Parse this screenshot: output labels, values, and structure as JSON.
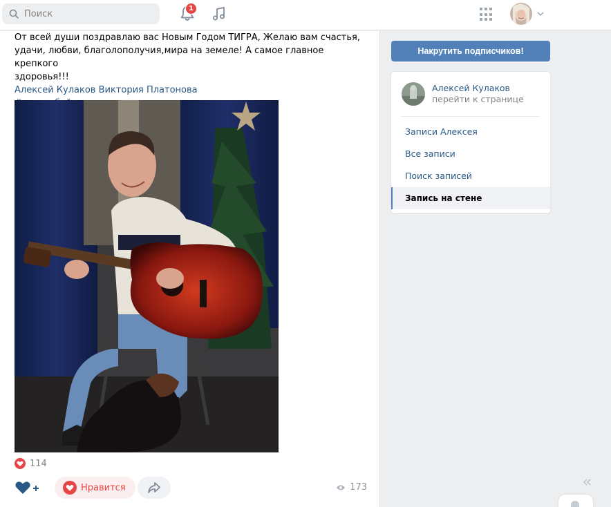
{
  "header": {
    "search_placeholder": "Поиск",
    "notifications_count": "1",
    "icons": [
      "search-icon",
      "bell-icon",
      "music-icon",
      "apps-grid-icon",
      "chevron-down-icon"
    ]
  },
  "post": {
    "text_line1": "От всей души поздравлаю вас Новым Годом ТИГРА, Желаю вам счастья,",
    "text_line2": "удачи, любви, благолополучия,мира на земеле! А самое главное крепкого",
    "text_line3": "здоровья!!!",
    "mentions": "Алексей Кулаков Виктория Платонова",
    "hashtag": "#курткобейн",
    "likes": "114",
    "like_label": "Нравится",
    "views": "173"
  },
  "sidebar": {
    "promo_button": "Накрутить подписчиков!",
    "owner_name": "Алексей Кулаков",
    "owner_link": "перейти к странице",
    "menu": [
      {
        "label": "Записи Алексея"
      },
      {
        "label": "Все записи"
      },
      {
        "label": "Поиск записей"
      },
      {
        "label": "Запись на стене"
      }
    ]
  },
  "colors": {
    "accent": "#5181b8",
    "link": "#2a5885",
    "like_red": "#e64646",
    "background": "#edeef0"
  }
}
